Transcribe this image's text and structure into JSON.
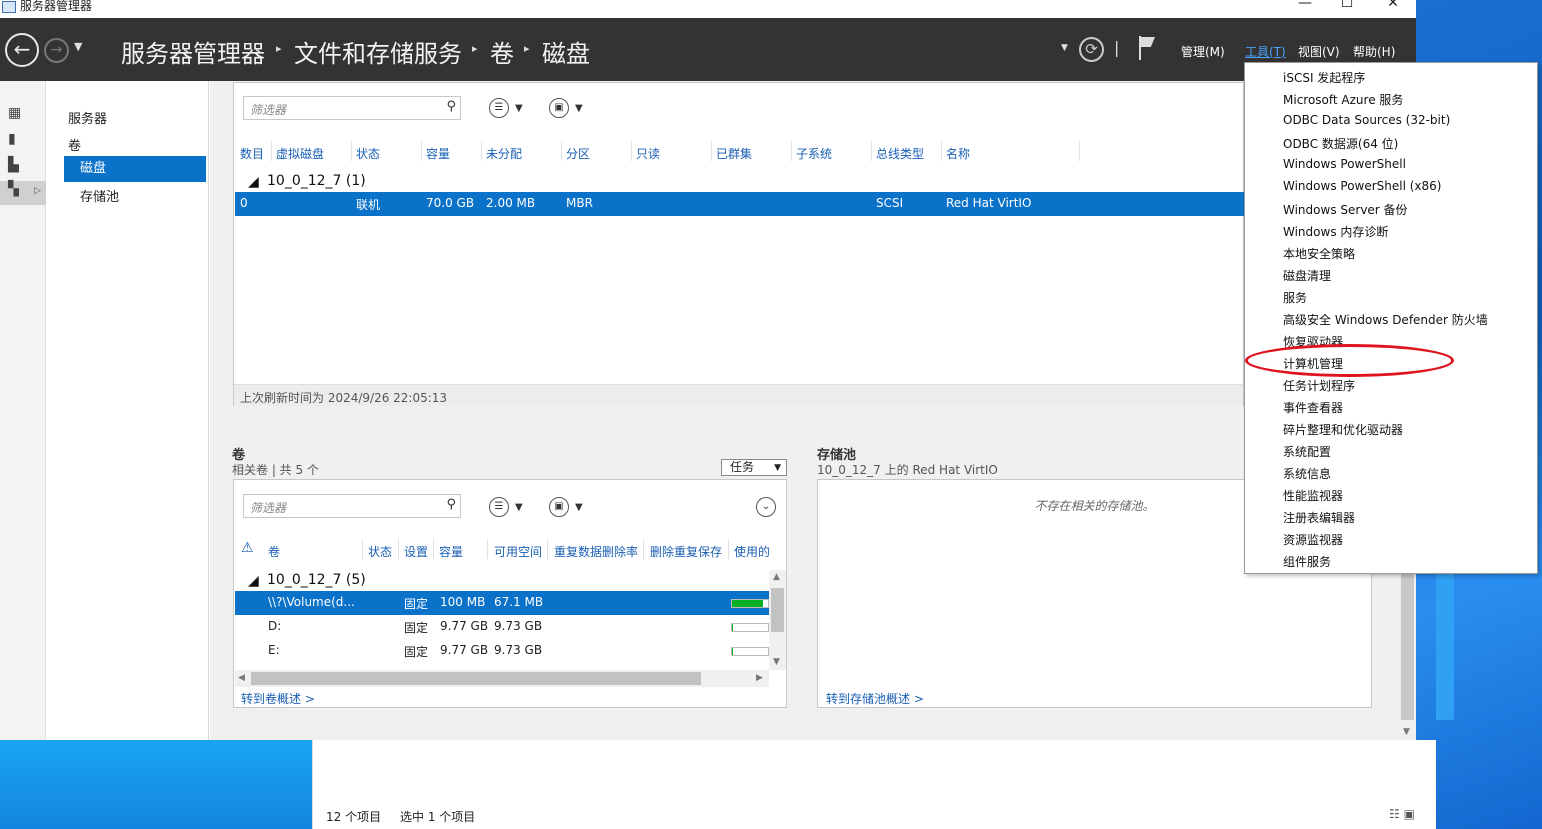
{
  "window": {
    "title": "服务器管理器"
  },
  "controls": {
    "minimize": "—",
    "maximize": "☐",
    "close": "✕"
  },
  "breadcrumb": [
    "服务器管理器",
    "文件和存储服务",
    "卷",
    "磁盘"
  ],
  "header_menu": {
    "manage": "管理(M)",
    "tools": "工具(T)",
    "view": "视图(V)",
    "help": "帮助(H)"
  },
  "nav": {
    "servers": "服务器",
    "volumes": "卷",
    "disks": "磁盘",
    "pools": "存储池"
  },
  "disks": {
    "filter_placeholder": "筛选器",
    "columns": [
      "数目",
      "虚拟磁盘",
      "状态",
      "容量",
      "未分配",
      "分区",
      "只读",
      "已群集",
      "子系统",
      "总线类型",
      "名称"
    ],
    "group": "10_0_12_7 (1)",
    "row": {
      "number": "0",
      "status": "联机",
      "capacity": "70.0 GB",
      "unallocated": "2.00 MB",
      "partition": "MBR",
      "bus": "SCSI",
      "name": "Red Hat VirtIO"
    },
    "footer": "上次刷新时间为 2024/9/26 22:05:13"
  },
  "volumes": {
    "title": "卷",
    "subtitle": "相关卷 | 共 5 个",
    "task_label": "任务",
    "filter_placeholder": "筛选器",
    "columns": [
      "卷",
      "状态",
      "设置",
      "容量",
      "可用空间",
      "重复数据删除率",
      "删除重复保存",
      "使用的"
    ],
    "group": "10_0_12_7 (5)",
    "rows": [
      {
        "name": "\\\\?\\Volume(d...",
        "setting": "固定",
        "capacity": "100 MB",
        "free": "67.1 MB",
        "usage": 0.85,
        "selected": true
      },
      {
        "name": "D:",
        "setting": "固定",
        "capacity": "9.77 GB",
        "free": "9.73 GB",
        "usage": 0.01,
        "selected": false
      },
      {
        "name": "E:",
        "setting": "固定",
        "capacity": "9.77 GB",
        "free": "9.73 GB",
        "usage": 0.01,
        "selected": false
      }
    ],
    "link": "转到卷概述 >"
  },
  "pools": {
    "title": "存储池",
    "subtitle": "10_0_12_7 上的 Red Hat VirtIO",
    "empty": "不存在相关的存储池。",
    "link": "转到存储池概述 >"
  },
  "tools_menu": [
    "iSCSI 发起程序",
    "Microsoft Azure 服务",
    "ODBC Data Sources (32-bit)",
    "ODBC 数据源(64 位)",
    "Windows PowerShell",
    "Windows PowerShell (x86)",
    "Windows Server 备份",
    "Windows 内存诊断",
    "本地安全策略",
    "磁盘清理",
    "服务",
    "高级安全 Windows Defender 防火墙",
    "恢复驱动器",
    "计算机管理",
    "任务计划程序",
    "事件查看器",
    "碎片整理和优化驱动器",
    "系统配置",
    "系统信息",
    "性能监视器",
    "注册表编辑器",
    "资源监视器",
    "组件服务"
  ],
  "explorer_status": {
    "count": "12 个项目",
    "selected": "选中 1 个项目"
  },
  "colors": {
    "accent": "#0a72c8",
    "header": "#333333",
    "highlight": "#e0141e"
  }
}
